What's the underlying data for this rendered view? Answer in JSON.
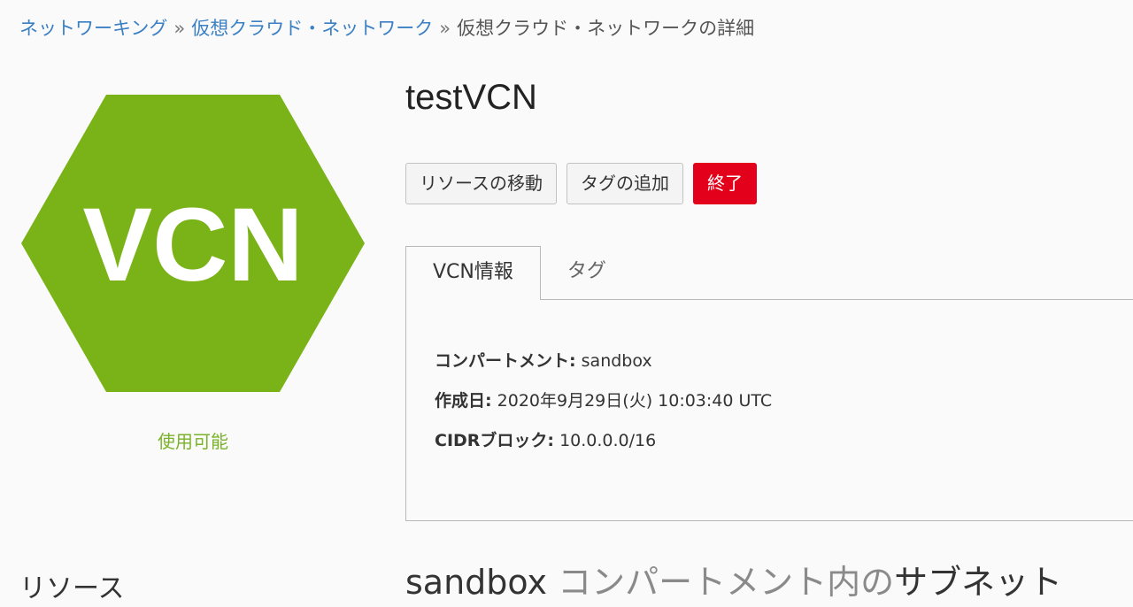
{
  "breadcrumb": {
    "items": [
      "ネットワーキング",
      "仮想クラウド・ネットワーク"
    ],
    "separator": "»",
    "current": "仮想クラウド・ネットワークの詳細"
  },
  "resource_icon": {
    "label": "VCN",
    "shape": "hexagon-icon",
    "color": "#7ab317"
  },
  "status": {
    "text": "使用可能",
    "color": "#7ab22a"
  },
  "title": "testVCN",
  "actions": {
    "move_label": "リソースの移動",
    "add_tag_label": "タグの追加",
    "terminate_label": "終了",
    "terminate_color": "#e3001b"
  },
  "tabs": [
    {
      "label": "VCN情報",
      "active": true
    },
    {
      "label": "タグ",
      "active": false
    }
  ],
  "info": {
    "compartment": {
      "label": "コンパートメント:",
      "value": "sandbox"
    },
    "created": {
      "label": "作成日:",
      "value": "2020年9月29日(火) 10:03:40 UTC"
    },
    "cidr": {
      "label": "CIDRブロック:",
      "value": "10.0.0.0/16"
    }
  },
  "resources_heading": "リソース",
  "subnet_heading": {
    "part1": "sandbox",
    "part2": "コンパートメント内の",
    "part3": "サブネット"
  }
}
